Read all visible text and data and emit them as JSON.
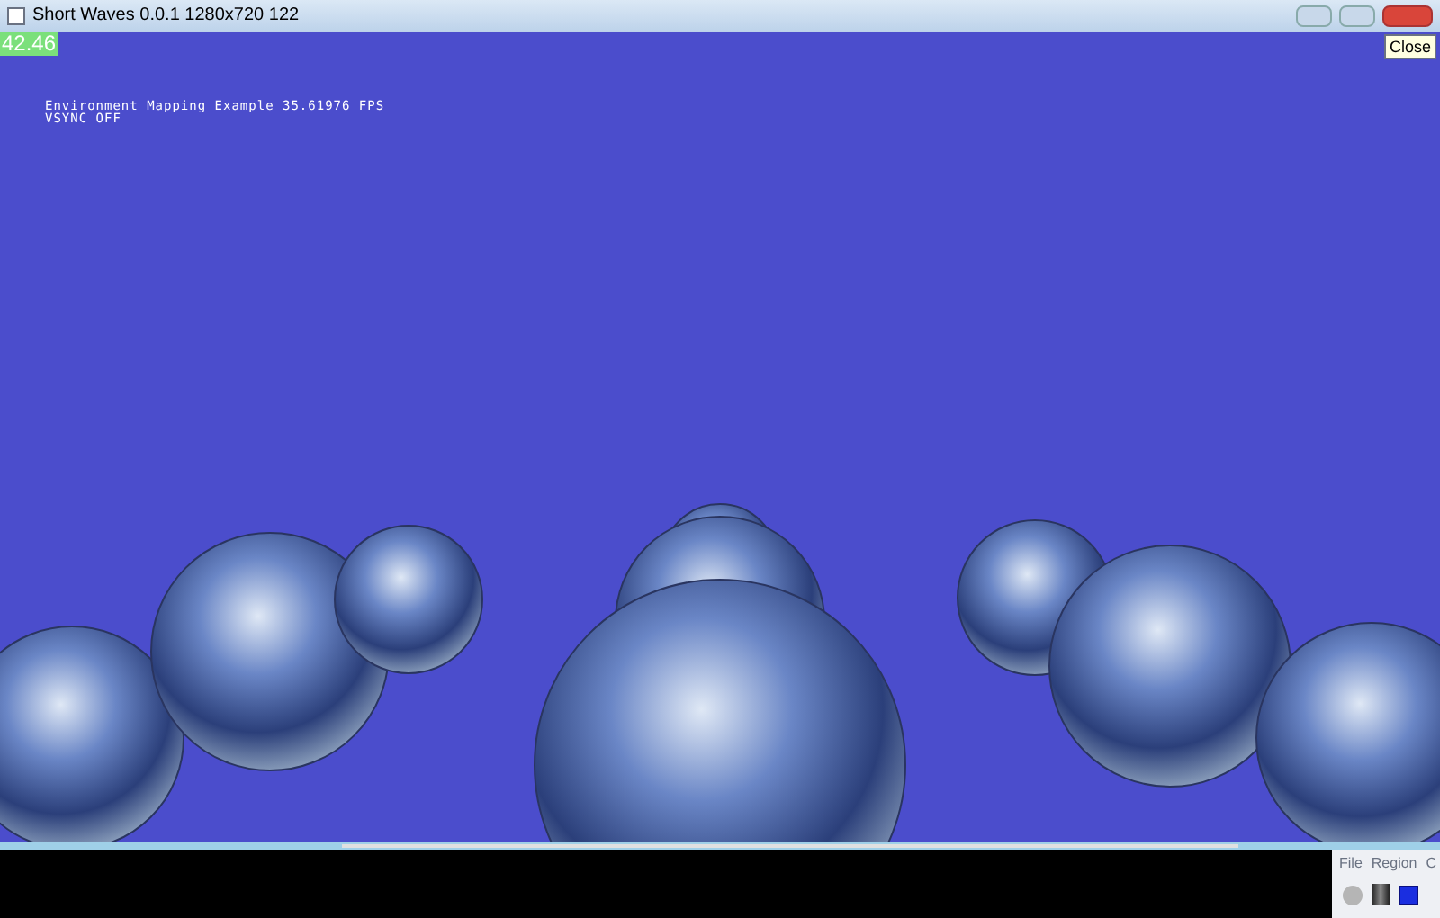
{
  "window": {
    "title": "Short Waves 0.0.1 1280x720 122",
    "close_tooltip": "Close"
  },
  "viewport": {
    "fps_badge": "42.46",
    "overlay_lines": [
      "Environment Mapping Example 35.61976 FPS",
      "VSYNC OFF"
    ]
  },
  "panel": {
    "menu": [
      "File",
      "Region",
      "C"
    ]
  }
}
